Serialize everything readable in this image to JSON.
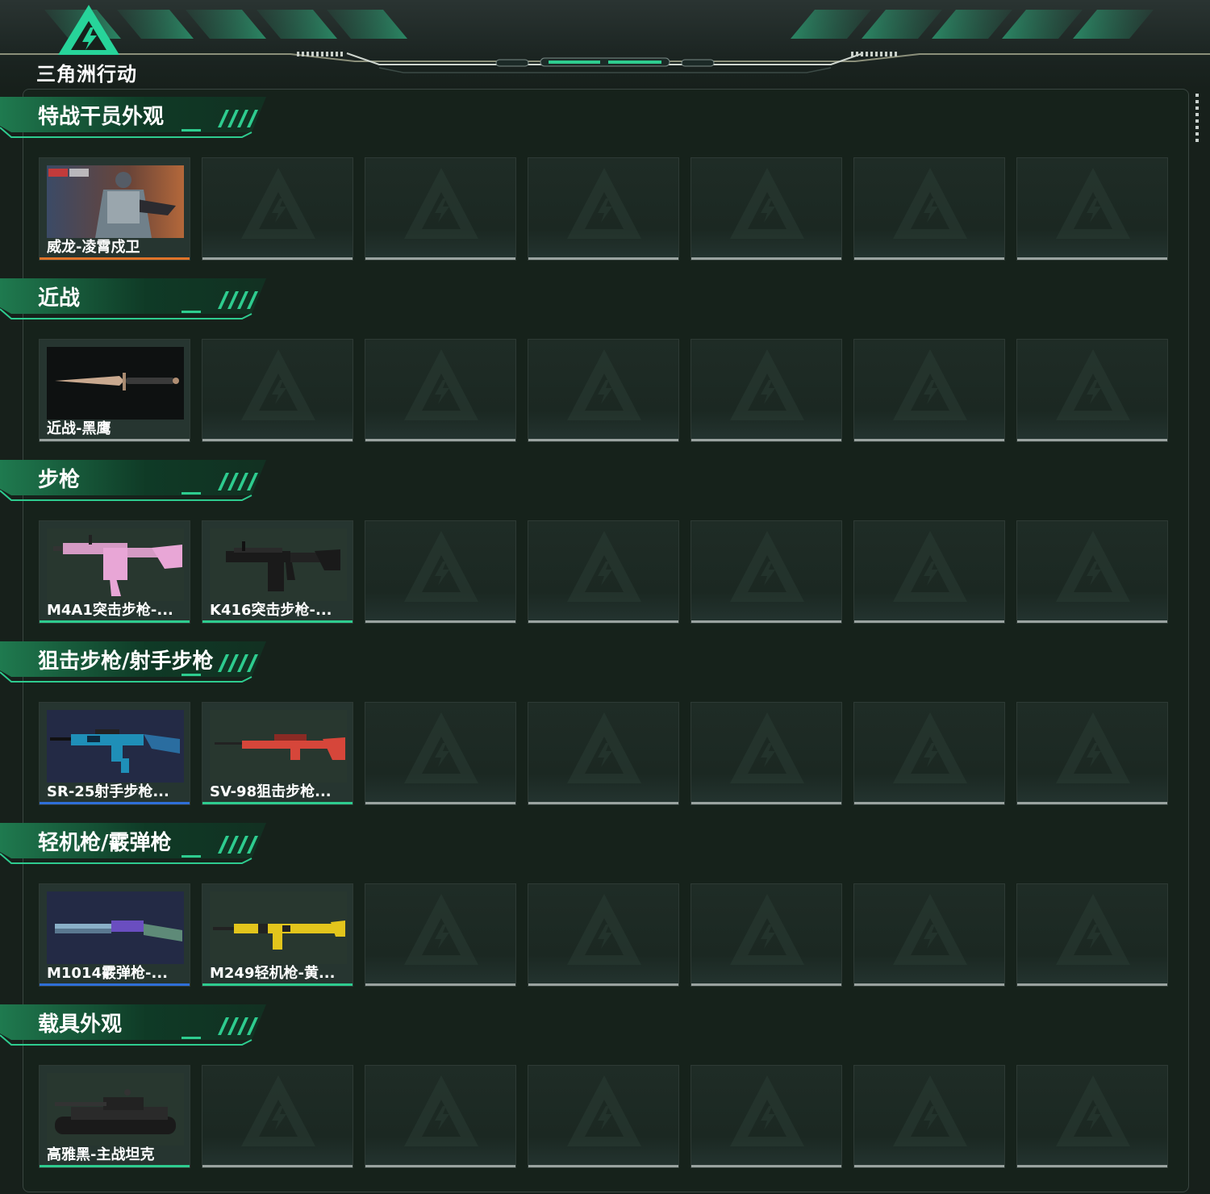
{
  "app": {
    "logo_text": "三角洲行动",
    "accent_color": "#2ecc8f"
  },
  "sections": [
    {
      "title": "特战干员外观",
      "items": [
        {
          "label": "威龙-凌霄戍卫",
          "rarity_color": "#e0742a",
          "thumb": "operator"
        }
      ]
    },
    {
      "title": "近战",
      "items": [
        {
          "label": "近战-黑鹰",
          "rarity_color": "#9aa3a0",
          "thumb": "knife"
        }
      ]
    },
    {
      "title": "步枪",
      "items": [
        {
          "label": "M4A1突击步枪-...",
          "rarity_color": "#2ecc8f",
          "thumb": "rifle-pink"
        },
        {
          "label": "K416突击步枪-...",
          "rarity_color": "#2ecc8f",
          "thumb": "rifle-black"
        }
      ]
    },
    {
      "title": "狙击步枪/射手步枪",
      "items": [
        {
          "label": "SR-25射手步枪...",
          "rarity_color": "#2f6fd8",
          "thumb": "rifle-blue"
        },
        {
          "label": "SV-98狙击步枪...",
          "rarity_color": "#2ecc8f",
          "thumb": "sniper-red"
        }
      ]
    },
    {
      "title": "轻机枪/霰弹枪",
      "items": [
        {
          "label": "M1014霰弹枪-...",
          "rarity_color": "#2f6fd8",
          "thumb": "shotgun"
        },
        {
          "label": "M249轻机枪-黄...",
          "rarity_color": "#2ecc8f",
          "thumb": "lmg-yellow"
        }
      ]
    },
    {
      "title": "载具外观",
      "items": [
        {
          "label": "高雅黑-主战坦克",
          "rarity_color": "#2ecc8f",
          "thumb": "tank"
        }
      ]
    }
  ]
}
